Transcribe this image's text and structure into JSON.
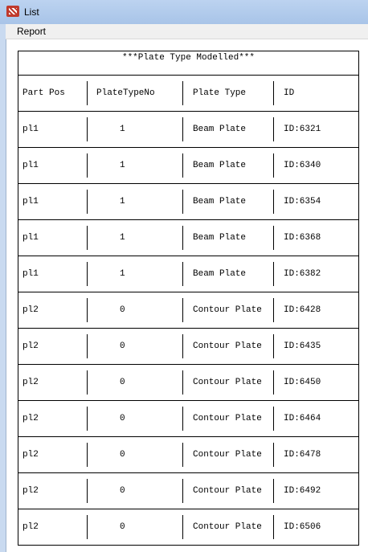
{
  "window": {
    "title": "List"
  },
  "menu": {
    "report": "Report"
  },
  "report": {
    "title": "***Plate Type Modelled***",
    "columns": [
      "Part Pos",
      "PlateTypeNo",
      "Plate Type",
      "ID"
    ],
    "rows": [
      {
        "part_pos": "pl1",
        "plate_type_no": "1",
        "plate_type": "Beam Plate",
        "id": "ID:6321"
      },
      {
        "part_pos": "pl1",
        "plate_type_no": "1",
        "plate_type": "Beam Plate",
        "id": "ID:6340"
      },
      {
        "part_pos": "pl1",
        "plate_type_no": "1",
        "plate_type": "Beam Plate",
        "id": "ID:6354"
      },
      {
        "part_pos": "pl1",
        "plate_type_no": "1",
        "plate_type": "Beam Plate",
        "id": "ID:6368"
      },
      {
        "part_pos": "pl1",
        "plate_type_no": "1",
        "plate_type": "Beam Plate",
        "id": "ID:6382"
      },
      {
        "part_pos": "pl2",
        "plate_type_no": "0",
        "plate_type": "Contour Plate",
        "id": "ID:6428"
      },
      {
        "part_pos": "pl2",
        "plate_type_no": "0",
        "plate_type": "Contour Plate",
        "id": "ID:6435"
      },
      {
        "part_pos": "pl2",
        "plate_type_no": "0",
        "plate_type": "Contour Plate",
        "id": "ID:6450"
      },
      {
        "part_pos": "pl2",
        "plate_type_no": "0",
        "plate_type": "Contour Plate",
        "id": "ID:6464"
      },
      {
        "part_pos": "pl2",
        "plate_type_no": "0",
        "plate_type": "Contour Plate",
        "id": "ID:6478"
      },
      {
        "part_pos": "pl2",
        "plate_type_no": "0",
        "plate_type": "Contour Plate",
        "id": "ID:6492"
      },
      {
        "part_pos": "pl2",
        "plate_type_no": "0",
        "plate_type": "Contour Plate",
        "id": "ID:6506"
      }
    ]
  }
}
